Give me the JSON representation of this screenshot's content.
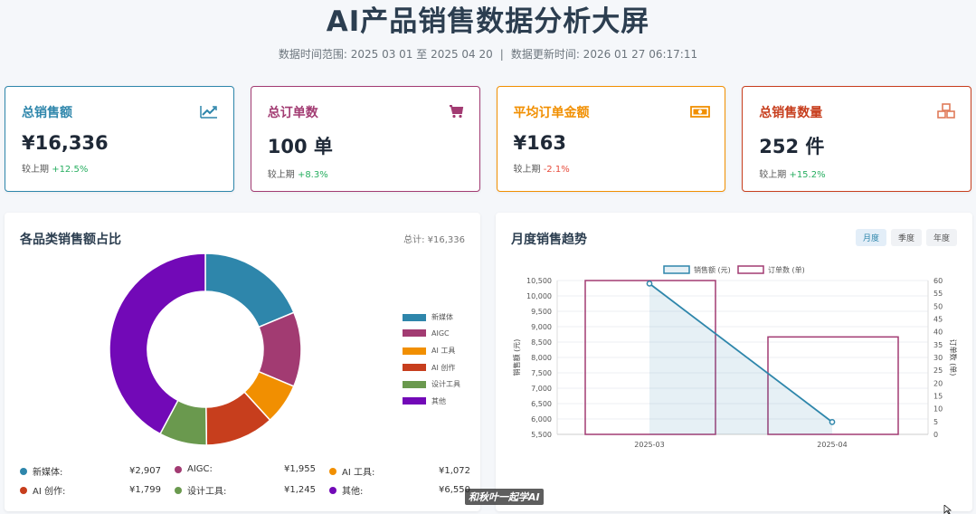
{
  "header": {
    "title": "AI产品销售数据分析大屏",
    "range": "数据时间范围: 2025 03 01 至 2025 04 20",
    "separator": "|",
    "updated": "数据更新时间: 2026 01 27 06:17:11"
  },
  "kpis": [
    {
      "title": "总销售额",
      "value": "¥16,336",
      "compare_label": "较上期",
      "delta": "+12.5%",
      "trend": "up",
      "color": "#2e86ab",
      "icon": "trend-up-icon"
    },
    {
      "title": "总订单数",
      "value": "100 单",
      "compare_label": "较上期",
      "delta": "+8.3%",
      "trend": "up",
      "color": "#a23b72",
      "icon": "cart-icon"
    },
    {
      "title": "平均订单金额",
      "value": "¥163",
      "compare_label": "较上期",
      "delta": "-2.1%",
      "trend": "down",
      "color": "#f18f01",
      "icon": "money-icon"
    },
    {
      "title": "总销售数量",
      "value": "252 件",
      "compare_label": "较上期",
      "delta": "+15.2%",
      "trend": "up",
      "color": "#c73e1d",
      "icon": "boxes-icon"
    }
  ],
  "pie_panel": {
    "title": "各品类销售额占比",
    "total": "总计: ¥16,336",
    "stats": [
      {
        "name": "新媒体:",
        "value": "¥2,907",
        "color": "#2e86ab"
      },
      {
        "name": "AIGC:",
        "value": "¥1,955",
        "color": "#a23b72"
      },
      {
        "name": "AI 工具:",
        "value": "¥1,072",
        "color": "#f18f01"
      },
      {
        "name": "AI 创作:",
        "value": "¥1,799",
        "color": "#c73e1d"
      },
      {
        "name": "设计工具:",
        "value": "¥1,245",
        "color": "#6a994e"
      },
      {
        "name": "其他:",
        "value": "¥6,550",
        "color": "#7209b7"
      }
    ]
  },
  "line_panel": {
    "title": "月度销售趋势",
    "tabs": [
      "月度",
      "季度",
      "年度"
    ],
    "active_tab": 0
  },
  "chart_data": [
    {
      "type": "pie",
      "categories": [
        "新媒体",
        "AIGC",
        "AI 工具",
        "AI 创作",
        "设计工具",
        "其他"
      ],
      "values": [
        2907,
        1955,
        1072,
        1799,
        1245,
        6550
      ],
      "colors": [
        "#2e86ab",
        "#a23b72",
        "#f18f01",
        "#c73e1d",
        "#6a994e",
        "#7209b7"
      ],
      "legend": "right"
    },
    {
      "type": "line",
      "categories": [
        "2025-03",
        "2025-04"
      ],
      "series": [
        {
          "name": "销售额 (元)",
          "type": "area",
          "axis": "left",
          "values": [
            10400,
            5900
          ],
          "color": "#2e86ab"
        },
        {
          "name": "订单数 (单)",
          "type": "bar",
          "axis": "right",
          "values": [
            60,
            38
          ],
          "color": "#a23b72"
        }
      ],
      "ylabel": "销售额 (元)",
      "ylabel_right": "订单数 (单)",
      "ylim": [
        5500,
        10500
      ],
      "ylim_right": [
        0,
        60
      ],
      "yticks": [
        "5,500",
        "6,000",
        "6,500",
        "7,000",
        "7,500",
        "8,000",
        "8,500",
        "9,000",
        "9,500",
        "10,000",
        "10,500"
      ],
      "yticks_right": [
        "0",
        "5",
        "10",
        "15",
        "20",
        "25",
        "30",
        "35",
        "40",
        "45",
        "50",
        "55",
        "60"
      ],
      "legend": "top",
      "grid": true
    }
  ],
  "watermark": "和秋叶一起学AI"
}
